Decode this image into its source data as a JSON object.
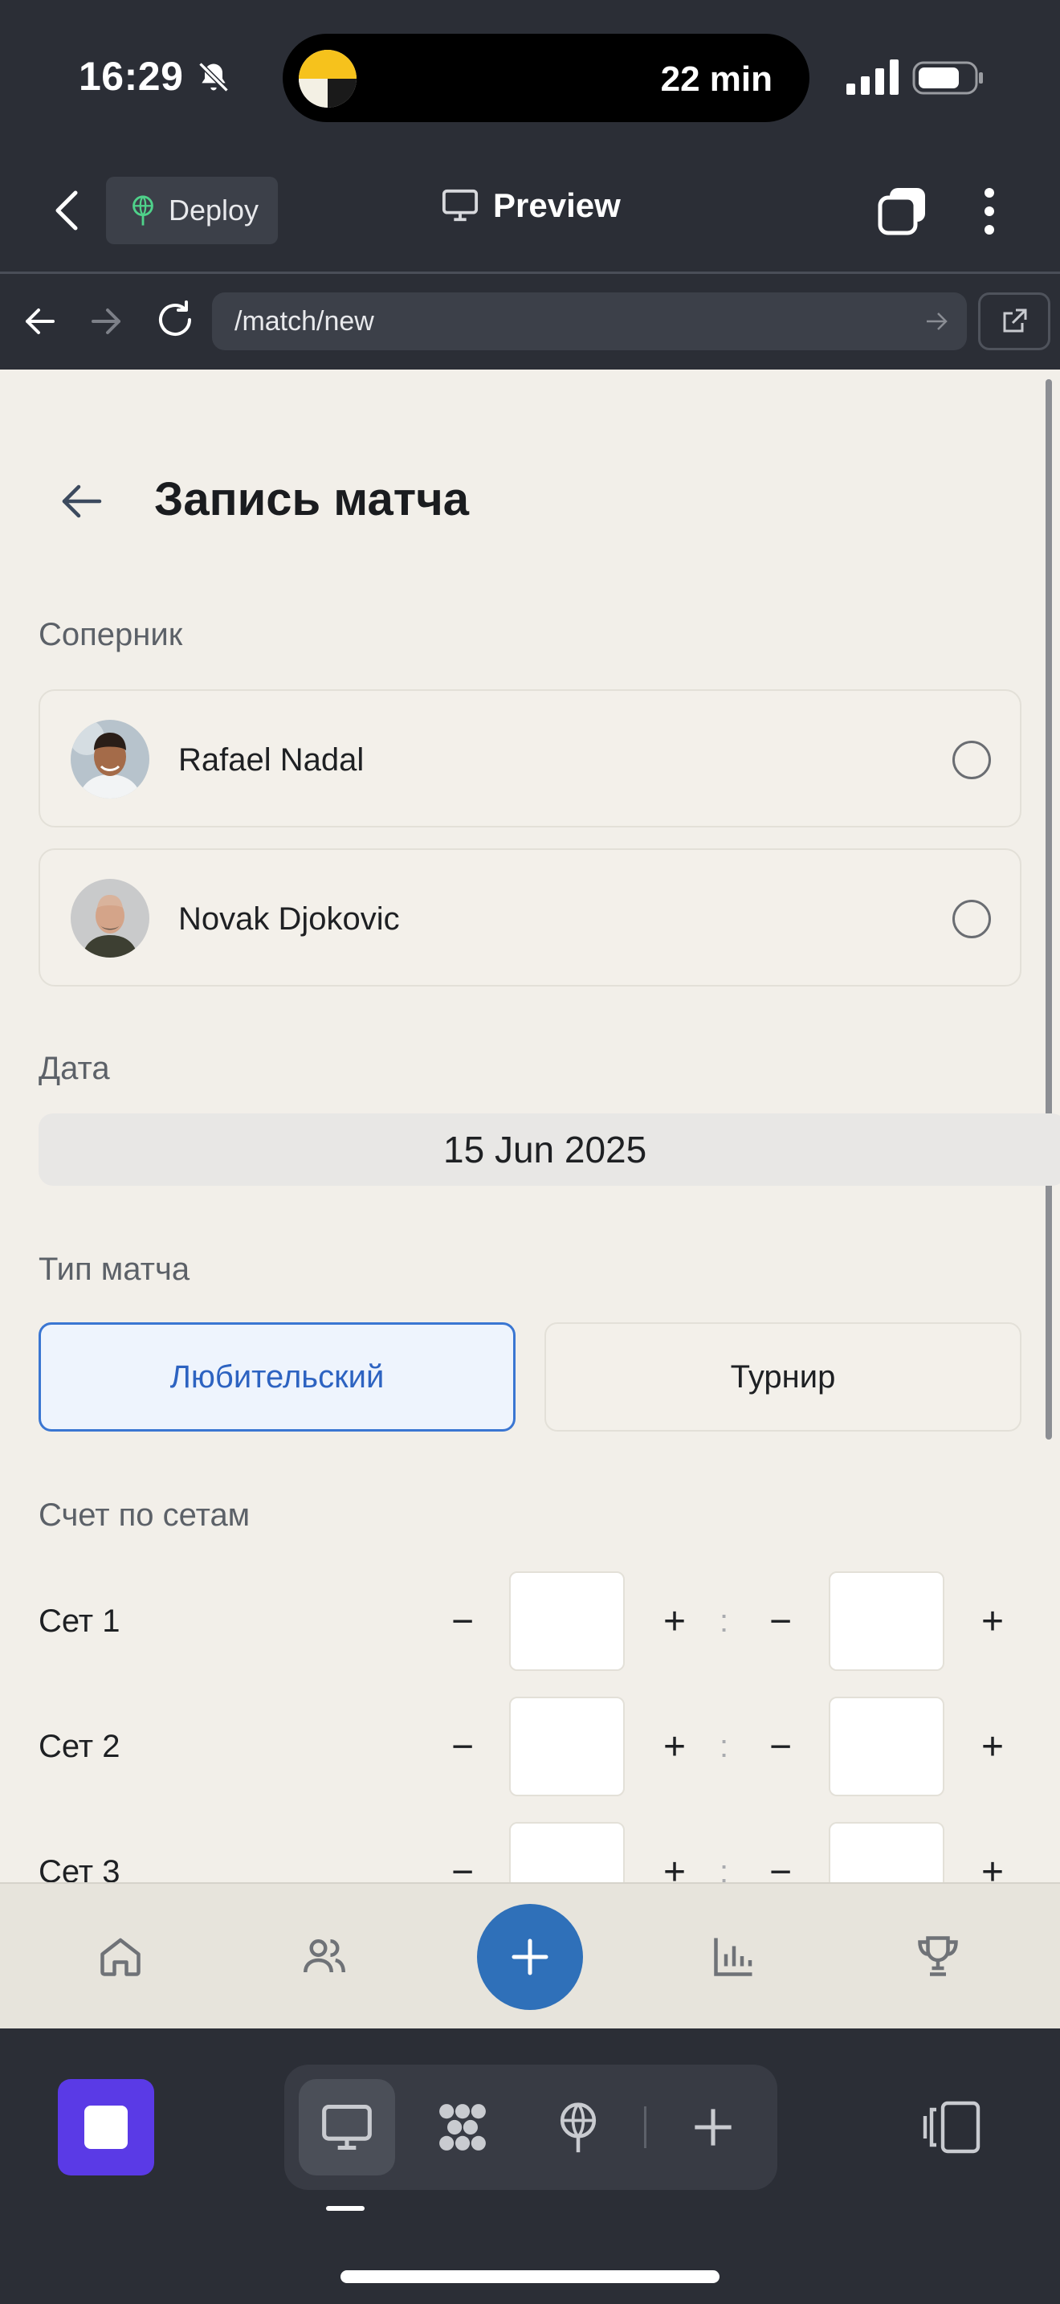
{
  "status_bar": {
    "time": "16:29",
    "island_text": "22 min"
  },
  "header": {
    "deploy_label": "Deploy",
    "preview_label": "Preview"
  },
  "browser": {
    "url": "/match/new"
  },
  "page": {
    "title": "Запись матча",
    "opponent_label": "Соперник",
    "opponents": [
      {
        "name": "Rafael Nadal",
        "selected": false
      },
      {
        "name": "Novak Djokovic",
        "selected": false
      }
    ],
    "date_label": "Дата",
    "date_value": "15 Jun 2025",
    "match_type_label": "Тип матча",
    "match_types": [
      {
        "label": "Любительский",
        "selected": true
      },
      {
        "label": "Турнир",
        "selected": false
      }
    ],
    "sets_label": "Счет по сетам",
    "sets": [
      {
        "label": "Сет 1",
        "score_a": "",
        "score_b": ""
      },
      {
        "label": "Сет 2",
        "score_a": "",
        "score_b": ""
      },
      {
        "label": "Сет 3",
        "score_a": "",
        "score_b": ""
      }
    ],
    "minus_symbol": "−",
    "plus_symbol": "+",
    "separator": ":"
  },
  "tabbar": {
    "items": [
      "home-icon",
      "users-icon",
      "plus-icon",
      "bar-chart-icon",
      "trophy-icon"
    ]
  },
  "dock": {
    "items": [
      "desktop-icon",
      "grid-icon",
      "deploy-icon",
      "add-icon"
    ]
  },
  "colors": {
    "accent": "#2f70b9",
    "selected_border": "#3a76d2",
    "selected_text": "#2d63c1",
    "app_tile": "#5a3ae6",
    "page_background": "#f2efe9",
    "chrome_background": "#2b2e36"
  }
}
